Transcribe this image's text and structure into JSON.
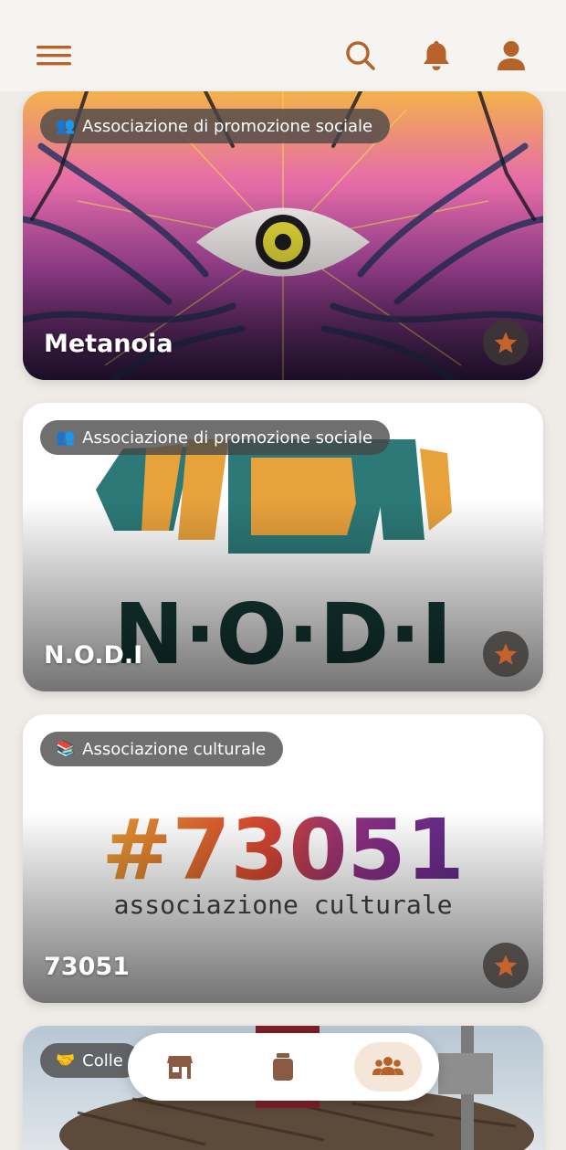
{
  "header": {
    "menu_icon": "hamburger-menu-icon",
    "search_icon": "search-icon",
    "notifications_icon": "bell-icon",
    "profile_icon": "user-icon"
  },
  "colors": {
    "accent": "#b5632a",
    "background": "#efece8"
  },
  "cards": [
    {
      "category_emoji": "👥",
      "category": "Associazione di promozione sociale",
      "title": "Metanoia"
    },
    {
      "category_emoji": "👥",
      "category": "Associazione di promozione sociale",
      "title": "N.O.D.I",
      "logo_text": "N·O·D·I"
    },
    {
      "category_emoji": "📚",
      "category": "Associazione culturale",
      "title": "73051",
      "logo_main": "#73051",
      "logo_sub": "associazione culturale"
    },
    {
      "category_emoji": "🤝",
      "category": "Colle"
    }
  ],
  "bottom_nav": {
    "items": [
      "shop-icon",
      "jar-icon",
      "groups-icon"
    ],
    "active": "groups-icon"
  }
}
